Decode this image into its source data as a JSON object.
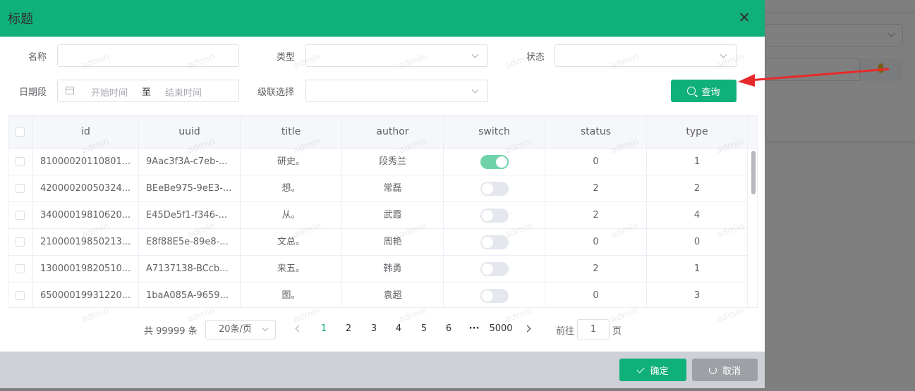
{
  "background": {
    "button_icon": "hand-icon",
    "button_glyph": "✋"
  },
  "dialog": {
    "title": "标题",
    "close_icon": "close-icon"
  },
  "form": {
    "name_label": "名称",
    "type_label": "类型",
    "status_label": "状态",
    "date_label": "日期段",
    "date_start_placeholder": "开始时间",
    "date_separator": "至",
    "date_end_placeholder": "结束时间",
    "cascade_label": "级联选择",
    "search_button": "查询"
  },
  "table": {
    "columns": [
      "id",
      "uuid",
      "title",
      "author",
      "switch",
      "status",
      "type"
    ],
    "rows": [
      {
        "id": "81000020110801...",
        "uuid": "9Aac3f3A-c7eb-...",
        "title": "研史。",
        "author": "段秀兰",
        "switch": true,
        "status": "0",
        "type": "1"
      },
      {
        "id": "42000020050324...",
        "uuid": "BEeBe975-9eE3-...",
        "title": "想。",
        "author": "常磊",
        "switch": false,
        "status": "2",
        "type": "2"
      },
      {
        "id": "34000019810620...",
        "uuid": "E45De5f1-f346-...",
        "title": "从。",
        "author": "武霞",
        "switch": false,
        "status": "2",
        "type": "4"
      },
      {
        "id": "21000019850213...",
        "uuid": "E8f88E5e-89e8-...",
        "title": "文总。",
        "author": "周艳",
        "switch": false,
        "status": "0",
        "type": "0"
      },
      {
        "id": "13000019820510...",
        "uuid": "A7137138-BCcb...",
        "title": "来五。",
        "author": "韩勇",
        "switch": false,
        "status": "2",
        "type": "1"
      },
      {
        "id": "65000019931220...",
        "uuid": "1baA085A-9659...",
        "title": "图。",
        "author": "袁超",
        "switch": false,
        "status": "0",
        "type": "3"
      }
    ]
  },
  "pagination": {
    "total": "共 99999 条",
    "page_size": "20条/页",
    "pages": [
      "1",
      "2",
      "3",
      "4",
      "5",
      "6"
    ],
    "ellipsis": "···",
    "last_page": "5000",
    "current_page": 1,
    "goto_label": "前往",
    "goto_value": "1",
    "page_suffix": "页"
  },
  "footer": {
    "ok_button": "确定",
    "cancel_button": "取消"
  },
  "watermark": "admin",
  "colors": {
    "primary": "#10b07a",
    "arrow": "#e82a2a",
    "switch_on": "#6fd3aa"
  }
}
